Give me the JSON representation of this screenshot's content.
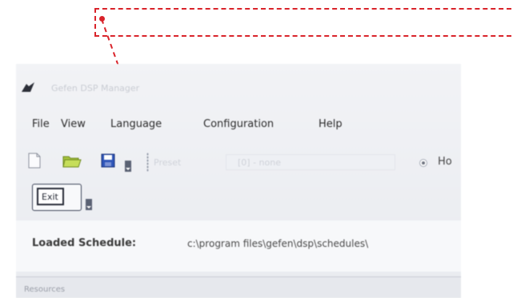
{
  "annotation": {
    "color": "#d9232a"
  },
  "window": {
    "title": "Gefen DSP Manager",
    "icon": "app-logo-icon"
  },
  "menu": {
    "file": "File",
    "view": "View",
    "language": "Language",
    "configuration": "Configuration",
    "help": "Help"
  },
  "toolbar": {
    "new_icon": "new-file-icon",
    "open_icon": "open-folder-icon",
    "save_icon": "save-icon",
    "preset_label": "Preset",
    "preset_value": "[0] - none",
    "radio_label": "Ho"
  },
  "exit": {
    "label": "Exit"
  },
  "loaded": {
    "label": "Loaded Schedule:",
    "path": "c:\\program files\\gefen\\dsp\\schedules\\"
  },
  "bottom": {
    "label": "Resources"
  }
}
